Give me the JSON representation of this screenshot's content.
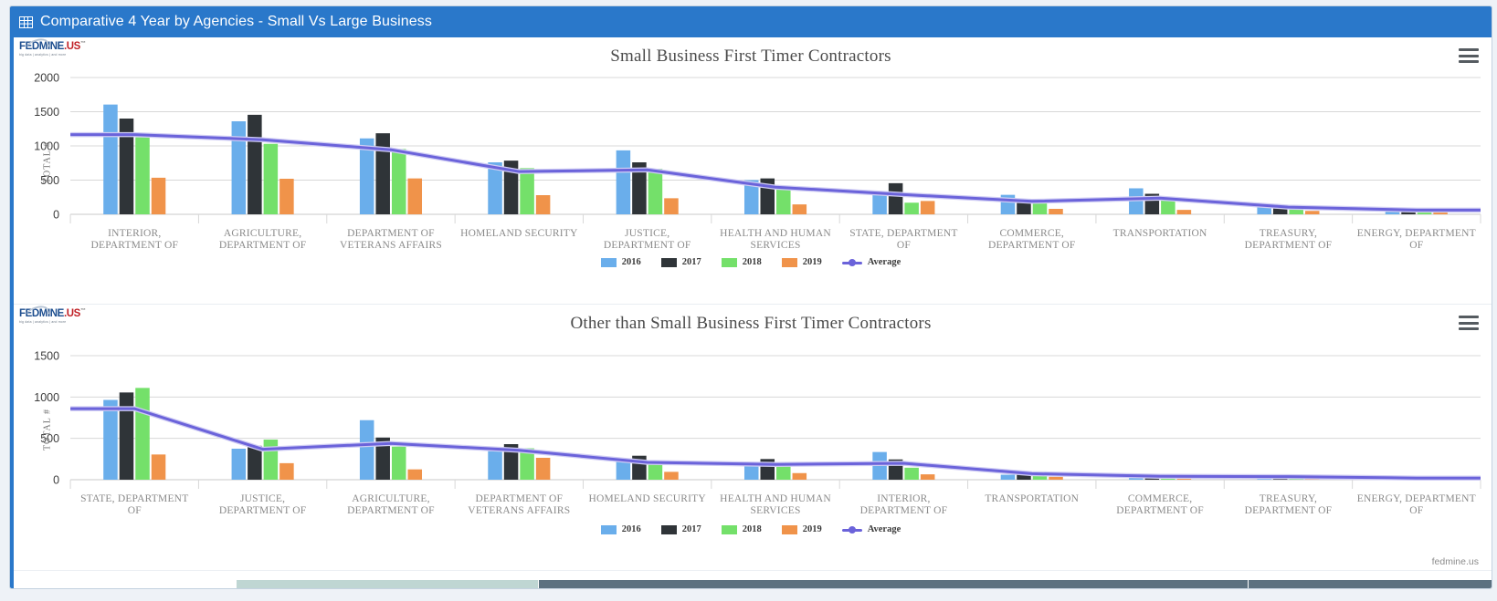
{
  "window": {
    "title": "Comparative 4 Year by Agencies - Small Vs Large Business",
    "grid_icon": "grid-icon"
  },
  "brand": {
    "name": "FEDMINE",
    "suffix": ".US",
    "tm": "™",
    "tagline": "big data | analytics | and more",
    "credits": "fedmine.us"
  },
  "menu": {
    "icon": "hamburger-menu-icon"
  },
  "legend": {
    "items": [
      {
        "label": "2016",
        "color": "#6aaeeb"
      },
      {
        "label": "2017",
        "color": "#2f3438"
      },
      {
        "label": "2018",
        "color": "#74e06a"
      },
      {
        "label": "2019",
        "color": "#f0934a"
      }
    ],
    "average_label": "Average",
    "average_color": "#6b63da"
  },
  "colors": {
    "accent": "#2a78ca",
    "series_2016": "#6aaeeb",
    "series_2017": "#2f3438",
    "series_2018": "#74e06a",
    "series_2019": "#f0934a",
    "average": "#6b63da",
    "grid": "#d8d8d8"
  },
  "chart_data": [
    {
      "type": "bar",
      "title": "Small Business First Timer Contractors",
      "xlabel": "",
      "ylabel": "TOTAL #",
      "ylim": [
        0,
        2000
      ],
      "yticks": [
        0,
        500,
        1000,
        1500,
        2000
      ],
      "grid": true,
      "legend_position": "bottom",
      "categories": [
        "INTERIOR, DEPARTMENT OF",
        "AGRICULTURE, DEPARTMENT OF",
        "DEPARTMENT OF VETERANS AFFAIRS",
        "HOMELAND SECURITY",
        "JUSTICE, DEPARTMENT OF",
        "HEALTH AND HUMAN SERVICES",
        "STATE, DEPARTMENT OF",
        "COMMERCE, DEPARTMENT OF",
        "TRANSPORTATION",
        "TREASURY, DEPARTMENT OF",
        "ENERGY, DEPARTMENT OF"
      ],
      "series": [
        {
          "name": "2016",
          "color": "#6aaeeb",
          "values": [
            1605,
            1360,
            1110,
            760,
            935,
            500,
            330,
            285,
            380,
            150,
            95
          ]
        },
        {
          "name": "2017",
          "color": "#2f3438",
          "values": [
            1400,
            1455,
            1185,
            785,
            760,
            525,
            455,
            200,
            300,
            115,
            75
          ]
        },
        {
          "name": "2018",
          "color": "#74e06a",
          "values": [
            1125,
            1030,
            955,
            675,
            665,
            420,
            170,
            190,
            200,
            105,
            40
          ]
        },
        {
          "name": "2019",
          "color": "#f0934a",
          "values": [
            535,
            520,
            525,
            280,
            235,
            145,
            195,
            80,
            65,
            50,
            35
          ]
        }
      ],
      "average": {
        "name": "Average",
        "color": "#6b63da",
        "values": [
          1166,
          1091,
          944,
          625,
          649,
          398,
          288,
          189,
          236,
          105,
          61
        ]
      }
    },
    {
      "type": "bar",
      "title": "Other than Small Business First Timer Contractors",
      "xlabel": "",
      "ylabel": "TOTAL #",
      "ylim": [
        0,
        1500
      ],
      "yticks": [
        0,
        500,
        1000,
        1500
      ],
      "grid": true,
      "legend_position": "bottom",
      "categories": [
        "STATE, DEPARTMENT OF",
        "JUSTICE, DEPARTMENT OF",
        "AGRICULTURE, DEPARTMENT OF",
        "DEPARTMENT OF VETERANS AFFAIRS",
        "HOMELAND SECURITY",
        "HEALTH AND HUMAN SERVICES",
        "INTERIOR, DEPARTMENT OF",
        "TRANSPORTATION",
        "COMMERCE, DEPARTMENT OF",
        "TREASURY, DEPARTMENT OF",
        "ENERGY, DEPARTMENT OF"
      ],
      "series": [
        {
          "name": "2016",
          "color": "#6aaeeb",
          "values": [
            965,
            375,
            720,
            345,
            240,
            210,
            335,
            60,
            50,
            40,
            30
          ]
        },
        {
          "name": "2017",
          "color": "#2f3438",
          "values": [
            1055,
            410,
            510,
            430,
            290,
            250,
            245,
            95,
            45,
            45,
            25
          ]
        },
        {
          "name": "2018",
          "color": "#74e06a",
          "values": [
            1110,
            485,
            400,
            380,
            215,
            195,
            145,
            100,
            45,
            35,
            20
          ]
        },
        {
          "name": "2019",
          "color": "#f0934a",
          "values": [
            305,
            200,
            125,
            265,
            95,
            80,
            65,
            35,
            25,
            30,
            5
          ]
        }
      ],
      "average": {
        "name": "Average",
        "color": "#6b63da",
        "values": [
          859,
          368,
          439,
          355,
          210,
          184,
          198,
          73,
          41,
          38,
          20
        ]
      }
    }
  ]
}
